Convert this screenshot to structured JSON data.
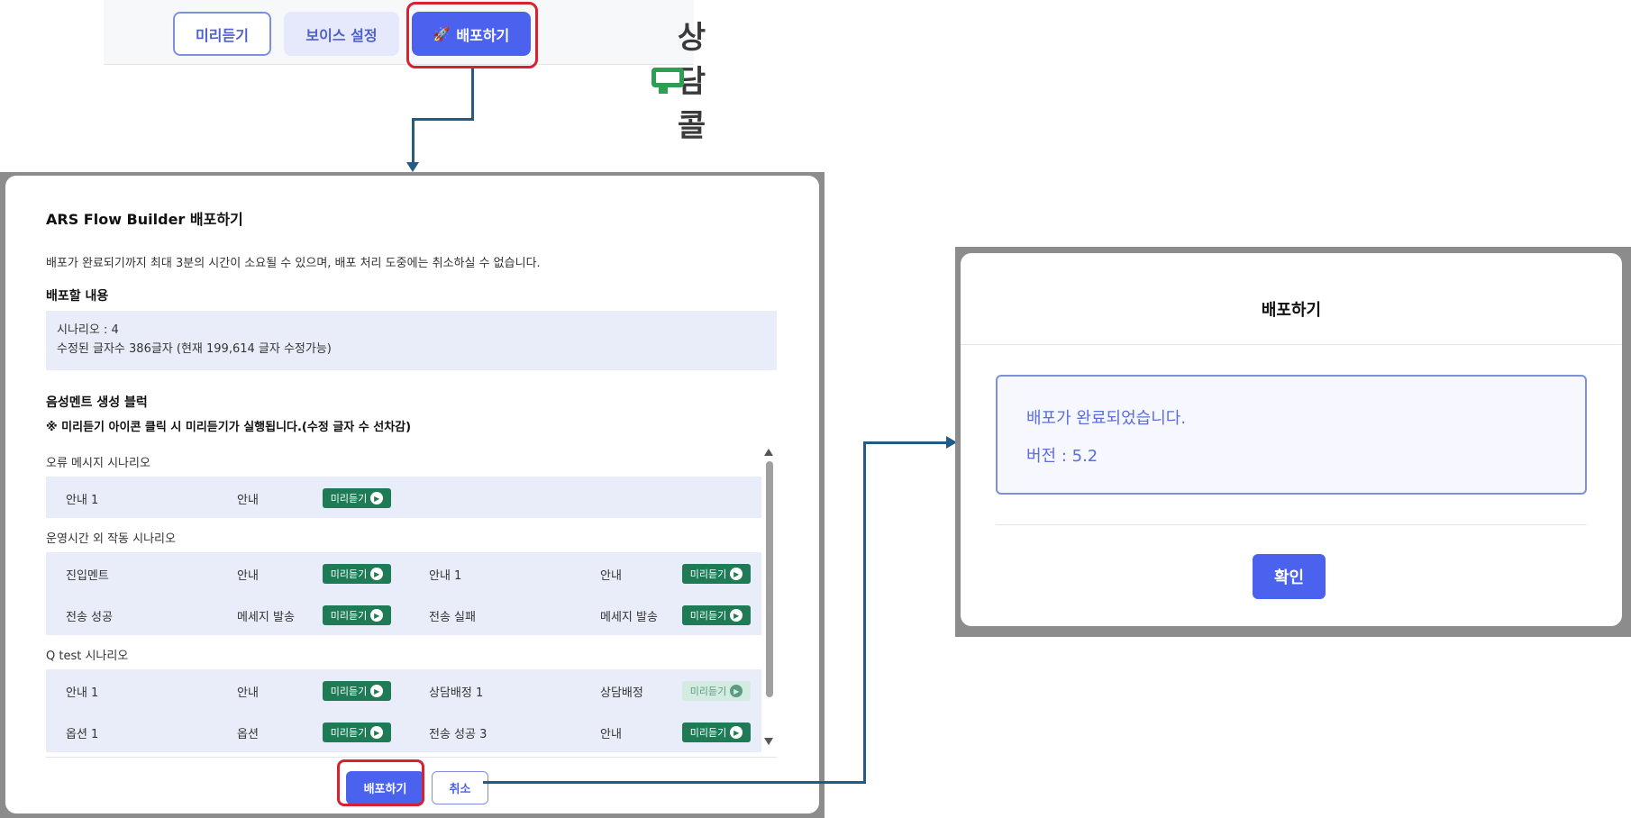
{
  "toolbar": {
    "preview_label": "미리듣기",
    "voice_label": "보이스 설정",
    "deploy_label": "배포하기",
    "logo_text": "상담콜",
    "accent": "#4a62ee"
  },
  "deploy_modal": {
    "title": "ARS Flow Builder 배포하기",
    "description": "배포가 완료되기까지 최대 3분의 시간이 소요될 수 있으며, 배포 처리 도중에는 취소하실 수 없습니다.",
    "content_heading": "배포할 내용",
    "scenario_line": "시나리오 : 4",
    "chars_line": "수정된 글자수 386글자 (현재 199,614 글자 수정가능)",
    "block_heading": "음성멘트 생성 블럭",
    "block_note": "※ 미리듣기 아이콘 클릭 시 미리듣기가 실행됩니다.(수정 글자 수 선차감)",
    "preview_btn": "미리듣기",
    "groups": [
      {
        "title": "오류 메시지 시나리오",
        "rows": [
          [
            {
              "name": "안내 1",
              "type": "안내",
              "enabled": true
            }
          ]
        ]
      },
      {
        "title": "운영시간 외 작동 시나리오",
        "rows": [
          [
            {
              "name": "진입멘트",
              "type": "안내",
              "enabled": true
            },
            {
              "name": "안내 1",
              "type": "안내",
              "enabled": true
            }
          ],
          [
            {
              "name": "전송 성공",
              "type": "메세지 발송",
              "enabled": true
            },
            {
              "name": "전송 실패",
              "type": "메세지 발송",
              "enabled": true
            }
          ]
        ]
      },
      {
        "title": "Q test 시나리오",
        "rows": [
          [
            {
              "name": "안내 1",
              "type": "안내",
              "enabled": true
            },
            {
              "name": "상담배정 1",
              "type": "상담배정",
              "enabled": false
            }
          ],
          [
            {
              "name": "옵션 1",
              "type": "옵션",
              "enabled": true
            },
            {
              "name": "전송 성공 3",
              "type": "안내",
              "enabled": true
            }
          ]
        ]
      }
    ],
    "deploy_btn": "배포하기",
    "cancel_btn": "취소"
  },
  "result_modal": {
    "title": "배포하기",
    "message": "배포가 완료되었습니다.",
    "version": "버전 : 5.2",
    "ok_btn": "확인"
  }
}
